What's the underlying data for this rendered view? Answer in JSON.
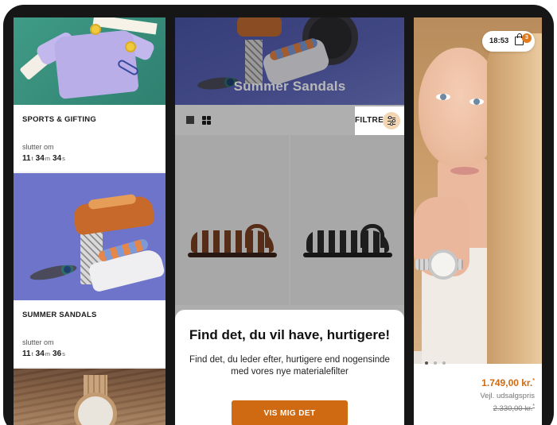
{
  "left_panel": {
    "tiles": [
      {
        "title": "SPORTS & GIFTING",
        "ends_label": "slutter om",
        "countdown": {
          "hours": "11",
          "hours_unit": "t",
          "minutes": "34",
          "minutes_unit": "m",
          "seconds": "34",
          "seconds_unit": "s"
        }
      },
      {
        "title": "SUMMER SANDALS",
        "ends_label": "slutter om",
        "countdown": {
          "hours": "11",
          "hours_unit": "t",
          "minutes": "34",
          "minutes_unit": "m",
          "seconds": "36",
          "seconds_unit": "s"
        }
      }
    ]
  },
  "middle_panel": {
    "banner_title": "Summer Sandals",
    "toolbar": {
      "filter_label": "FILTRE",
      "view_single_icon": "single-view-icon",
      "view_grid_icon": "grid-view-icon",
      "filter_icon": "sliders-icon"
    },
    "promo": {
      "title": "Find det, du vil have, hurtigere!",
      "body": "Find det, du leder efter, hurtigere end nogensinde med vores nye materialefilter",
      "cta": "VIS MIG DET"
    }
  },
  "right_panel": {
    "status": {
      "time": "18:53",
      "cart_count": "3",
      "cart_icon": "shopping-bag-icon"
    },
    "price": "1.749,00 kr.",
    "price_asterisk": "*",
    "rrp_label": "Vejl. udsalgspris",
    "rrp_value": "2.330,00 kr.",
    "rrp_asterisk": "*"
  },
  "colors": {
    "accent": "#cf6a12",
    "badge": "#e07a1c",
    "device_frame": "#161616"
  }
}
